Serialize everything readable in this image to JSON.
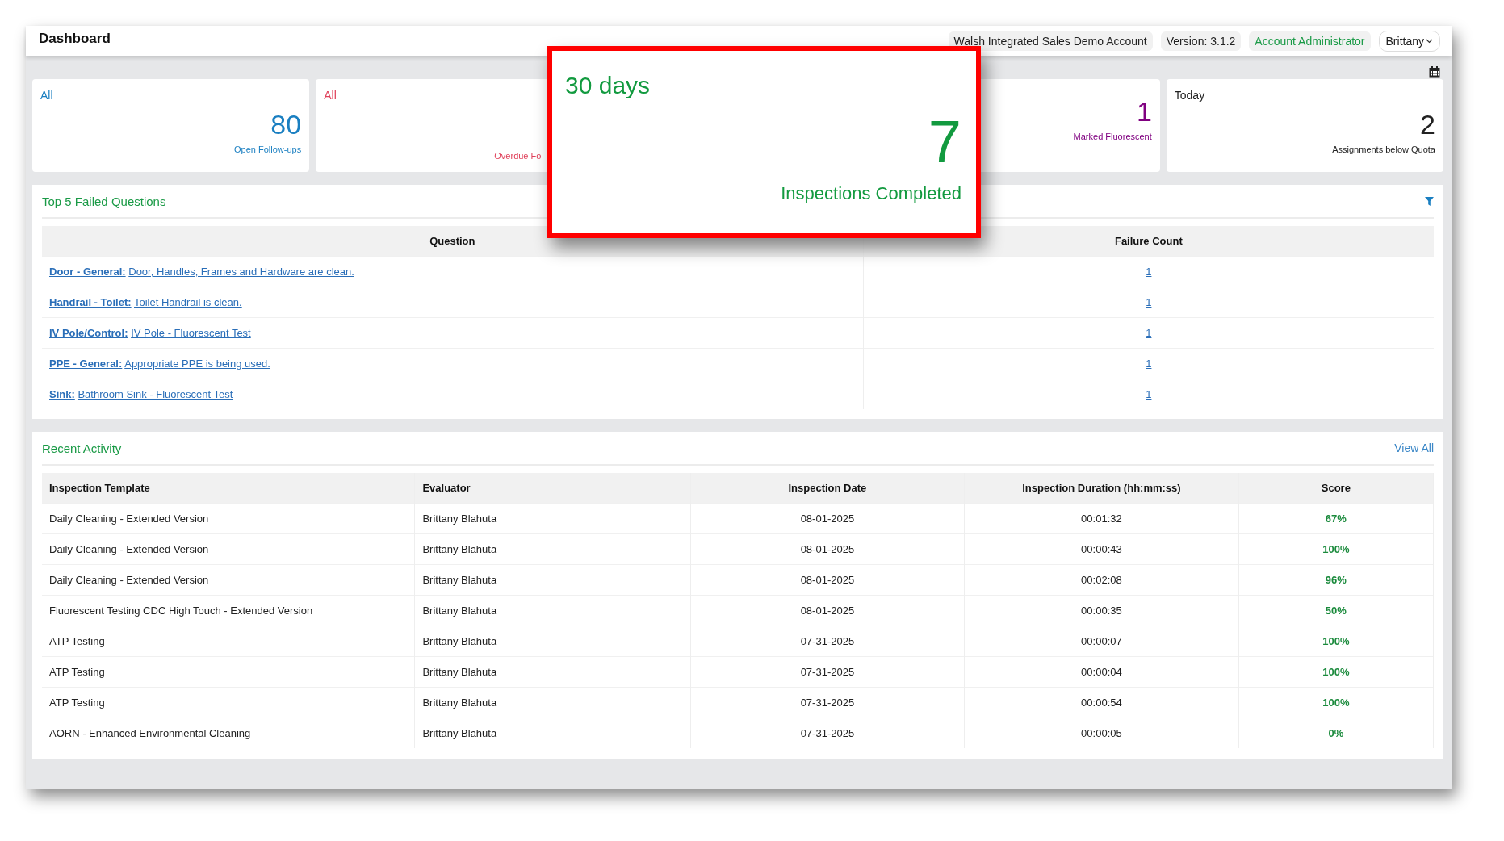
{
  "header": {
    "title": "Dashboard",
    "account": "Walsh Integrated Sales Demo Account",
    "version": "Version: 3.1.2",
    "role": "Account Administrator",
    "user": "Brittany"
  },
  "cards": [
    {
      "period": "All",
      "value": "80",
      "label": "Open Follow-ups",
      "color": "#1a7fc1"
    },
    {
      "period": "All",
      "label": "Overdue Fo",
      "color": "#e0405a"
    },
    {
      "value": "1",
      "label": "Marked Fluorescent",
      "color": "#800080"
    },
    {
      "period": "Today",
      "value": "2",
      "label": "Assignments below Quota",
      "color": "#222222"
    }
  ],
  "callout": {
    "period": "30 days",
    "value": "7",
    "label": "Inspections Completed"
  },
  "failed_questions": {
    "title": "Top 5 Failed Questions",
    "columns": [
      "Question",
      "Failure Count"
    ],
    "rows": [
      {
        "category": "Door - General:",
        "question": "Door, Handles, Frames and Hardware are clean.",
        "count": "1"
      },
      {
        "category": "Handrail - Toilet:",
        "question": "Toilet Handrail is clean.",
        "count": "1"
      },
      {
        "category": "IV Pole/Control:",
        "question": "IV Pole - Fluorescent Test",
        "count": "1"
      },
      {
        "category": "PPE - General:",
        "question": "Appropriate PPE is being used.",
        "count": "1"
      },
      {
        "category": "Sink:",
        "question": "Bathroom Sink - Fluorescent Test",
        "count": "1"
      }
    ]
  },
  "recent_activity": {
    "title": "Recent Activity",
    "view_all": "View All",
    "columns": [
      "Inspection Template",
      "Evaluator",
      "Inspection Date",
      "Inspection Duration (hh:mm:ss)",
      "Score"
    ],
    "rows": [
      [
        "Daily Cleaning - Extended Version",
        "Brittany Blahuta",
        "08-01-2025",
        "00:01:32",
        "67%"
      ],
      [
        "Daily Cleaning - Extended Version",
        "Brittany Blahuta",
        "08-01-2025",
        "00:00:43",
        "100%"
      ],
      [
        "Daily Cleaning - Extended Version",
        "Brittany Blahuta",
        "08-01-2025",
        "00:02:08",
        "96%"
      ],
      [
        "Fluorescent Testing CDC High Touch - Extended Version",
        "Brittany Blahuta",
        "08-01-2025",
        "00:00:35",
        "50%"
      ],
      [
        "ATP Testing",
        "Brittany Blahuta",
        "07-31-2025",
        "00:00:07",
        "100%"
      ],
      [
        "ATP Testing",
        "Brittany Blahuta",
        "07-31-2025",
        "00:00:04",
        "100%"
      ],
      [
        "ATP Testing",
        "Brittany Blahuta",
        "07-31-2025",
        "00:00:54",
        "100%"
      ],
      [
        "AORN - Enhanced Environmental Cleaning",
        "Brittany Blahuta",
        "07-31-2025",
        "00:00:05",
        "0%"
      ]
    ]
  }
}
